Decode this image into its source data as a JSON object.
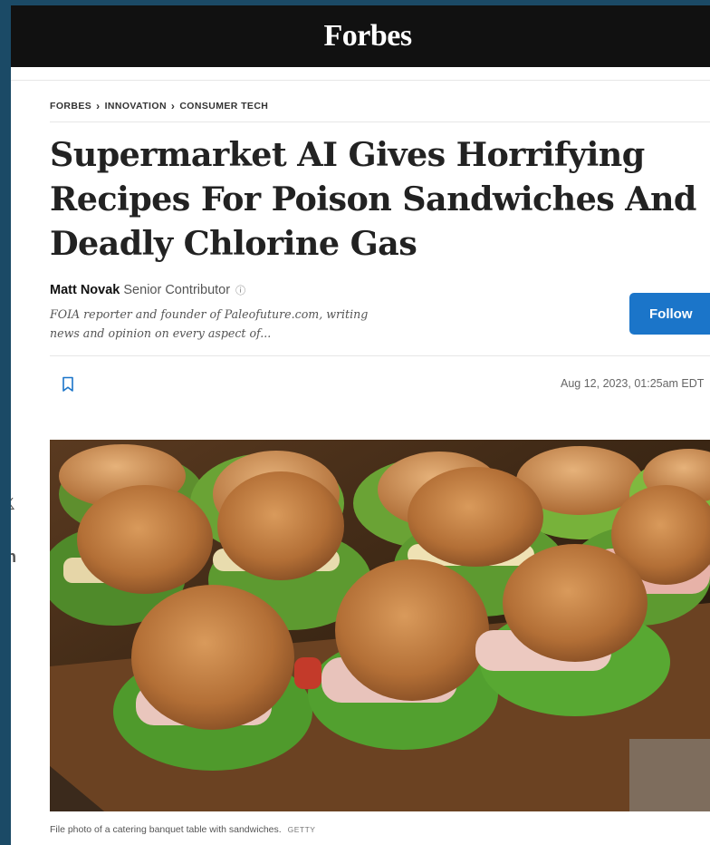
{
  "header": {
    "logo": "Forbes"
  },
  "breadcrumb": {
    "items": [
      "FORBES",
      "INNOVATION",
      "CONSUMER TECH"
    ]
  },
  "article": {
    "headline": "Supermarket AI Gives Horrifying Recipes For Poison Sandwiches And Deadly Chlorine Gas",
    "author_name": "Matt Novak",
    "author_role": "Senior Contributor",
    "author_bio": "FOIA reporter and founder of Paleofuture.com, writing news and opinion on every aspect of...",
    "follow_label": "Follow",
    "date": "Aug 12, 2023, 01:25am EDT",
    "caption": "File photo of a catering banquet table with sandwiches.",
    "caption_credit": "GETTY"
  },
  "social": {
    "facebook_glyph": "f",
    "x_glyph": "𝕏",
    "linkedin_glyph": "in"
  },
  "icons": {
    "info": "ⓘ",
    "chevron": "›"
  },
  "colors": {
    "accent": "#1b75c9",
    "topbar": "#111111",
    "outer_bg": "#1b4a66"
  }
}
